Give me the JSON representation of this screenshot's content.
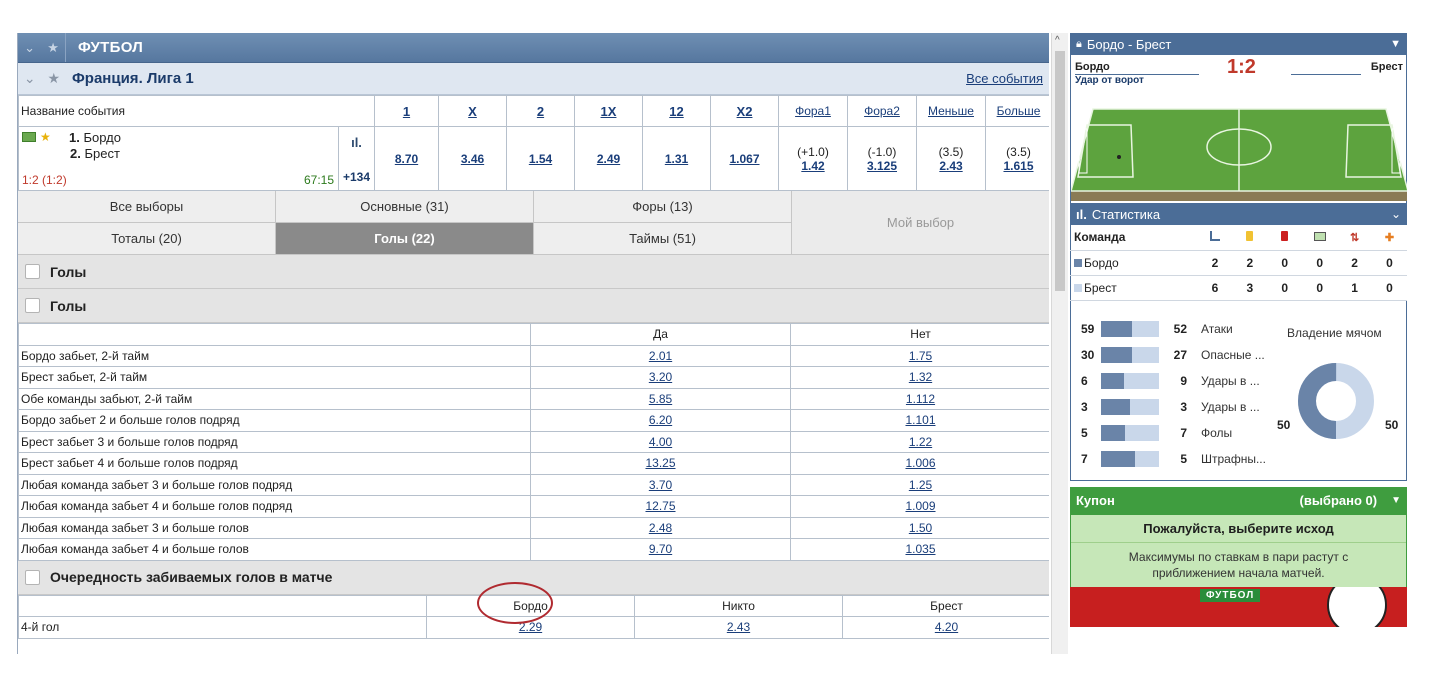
{
  "sport": {
    "title": "ФУТБОЛ"
  },
  "league": {
    "title": "Франция. Лига 1",
    "all_events": "Все события"
  },
  "odds_header": {
    "name": "Название события",
    "cols": [
      "1",
      "X",
      "2",
      "1X",
      "12",
      "X2"
    ],
    "fora1": "Фора1",
    "fora2": "Фора2",
    "less": "Меньше",
    "more": "Больше"
  },
  "event": {
    "team1_num": "1.",
    "team1": "Бордо",
    "team2_num": "2.",
    "team2": "Брест",
    "score": "1:2 (1:2)",
    "time": "67:15",
    "more": "+134",
    "odds": [
      "8.70",
      "3.46",
      "1.54",
      "2.49",
      "1.31",
      "1.067"
    ],
    "fora1_line": "(+1.0)",
    "fora1_val": "1.42",
    "fora2_line": "(-1.0)",
    "fora2_val": "3.125",
    "less_line": "(3.5)",
    "less_val": "2.43",
    "more_line": "(3.5)",
    "more_val": "1.615"
  },
  "filters": {
    "all": "Все выборы",
    "main": "Основные (31)",
    "fora": "Форы (13)",
    "totals": "Тоталы (20)",
    "goals": "Голы (22)",
    "halves": "Таймы (51)",
    "mine": "Мой выбор"
  },
  "sections": {
    "goals1": "Голы",
    "goals2": "Голы",
    "order": "Очередность забиваемых голов в матче"
  },
  "goals_market": {
    "yes": "Да",
    "no": "Нет",
    "rows": [
      {
        "name": "Бордо забьет, 2-й тайм",
        "yes": "2.01",
        "no": "1.75"
      },
      {
        "name": "Брест забьет, 2-й тайм",
        "yes": "3.20",
        "no": "1.32"
      },
      {
        "name": "Обе команды забьют, 2-й тайм",
        "yes": "5.85",
        "no": "1.112"
      },
      {
        "name": "Бордо забьет 2 и больше голов подряд",
        "yes": "6.20",
        "no": "1.101"
      },
      {
        "name": "Брест забьет 3 и больше голов подряд",
        "yes": "4.00",
        "no": "1.22"
      },
      {
        "name": "Брест забьет 4 и больше голов подряд",
        "yes": "13.25",
        "no": "1.006"
      },
      {
        "name": "Любая команда забьет 3 и больше голов подряд",
        "yes": "3.70",
        "no": "1.25"
      },
      {
        "name": "Любая команда забьет 4 и больше голов подряд",
        "yes": "12.75",
        "no": "1.009"
      },
      {
        "name": "Любая команда забьет 3 и больше голов",
        "yes": "2.48",
        "no": "1.50"
      },
      {
        "name": "Любая команда забьет 4 и больше голов",
        "yes": "9.70",
        "no": "1.035"
      }
    ]
  },
  "order_market": {
    "h1": "Бордо",
    "h2": "Никто",
    "h3": "Брест",
    "row": {
      "name": "4-й гол",
      "v1": "2.29",
      "v2": "2.43",
      "v3": "4.20"
    }
  },
  "match_widget": {
    "title": "Бордо - Брест",
    "team1": "Бордо",
    "team2": "Брест",
    "score": "1:2",
    "event": "Удар от ворот"
  },
  "stats": {
    "title": "Статистика",
    "team_col": "Команда",
    "rows": [
      {
        "team": "Бордо",
        "color": "#6a84a8",
        "vals": [
          "2",
          "2",
          "0",
          "0",
          "2",
          "0"
        ]
      },
      {
        "team": "Брест",
        "color": "#c9d7ea",
        "vals": [
          "6",
          "3",
          "0",
          "0",
          "1",
          "0"
        ]
      }
    ],
    "bars": [
      {
        "a": "59",
        "b": "52",
        "label": "Атаки",
        "frac": 0.53
      },
      {
        "a": "30",
        "b": "27",
        "label": "Опасные ...",
        "frac": 0.53
      },
      {
        "a": "6",
        "b": "9",
        "label": "Удары в ...",
        "frac": 0.4
      },
      {
        "a": "3",
        "b": "3",
        "label": "Удары в ...",
        "frac": 0.5
      },
      {
        "a": "5",
        "b": "7",
        "label": "Фолы",
        "frac": 0.42
      },
      {
        "a": "7",
        "b": "5",
        "label": "Штрафны...",
        "frac": 0.58
      }
    ],
    "possession_label": "Владение мячом",
    "possession_1": "50",
    "possession_2": "50"
  },
  "coupon": {
    "title": "Купон",
    "selected": "(выбрано 0)",
    "prompt": "Пожалуйста, выберите исход",
    "note": "Максимумы по ставкам в пари растут с приближением начала матчей.",
    "promo_tag": "ФУТБОЛ"
  }
}
